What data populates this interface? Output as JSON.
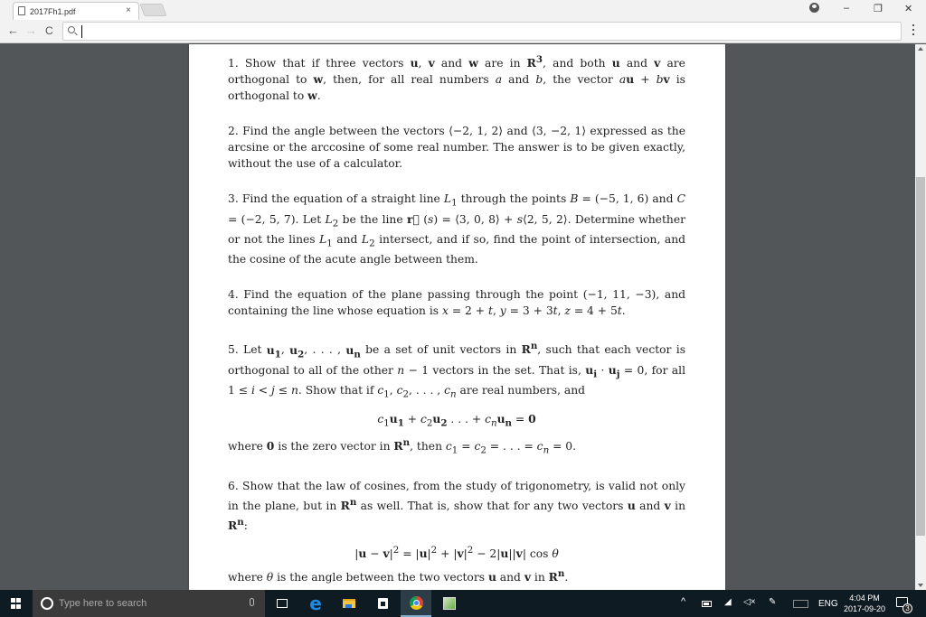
{
  "browser": {
    "tab_title": "2017Fh1.pdf",
    "tab_close": "×",
    "omnibox_value": "",
    "window_controls": {
      "minimize": "–",
      "restore": "❐",
      "close": "✕"
    },
    "nav": {
      "back": "←",
      "forward": "→",
      "reload": "C"
    }
  },
  "document": {
    "problems": [
      {
        "number": "1.",
        "html": "Show that if three vectors <b>u</b>, <b>v</b> and <b>w</b> are in <b>R</b><sup><b>3</b></sup>, and both <b>u</b> and <b>v</b> are orthogonal to <b>w</b>, then, for all real numbers <i>a</i> and <i>b</i>, the vector <i>a</i><b>u</b> + <i>b</i><b>v</b> is orthogonal to <b>w</b>."
      },
      {
        "number": "2.",
        "html": "Find the angle between the vectors ⟨−2, 1, 2⟩ and ⟨3, −2, 1⟩ expressed as the arcsine or the arccosine of some real number. The answer is to be given exactly, without the use of a calculator."
      },
      {
        "number": "3.",
        "html": "Find the equation of a straight line <i>L</i><sub>1</sub> through the points <i>B</i> = (−5, 1, 6) and <i>C</i> = (−2, 5, 7). Let <i>L</i><sub>2</sub> be the line <b>r⃗</b> (<i>s</i>) = ⟨3, 0, 8⟩ + <i>s</i>⟨2, 5, 2⟩. Determine whether or not the lines <i>L</i><sub>1</sub> and <i>L</i><sub>2</sub> intersect, and if so, find the point of intersection, and the cosine of the acute angle between them."
      },
      {
        "number": "4.",
        "html": "Find the equation of the plane passing through the point (−1, 11, −3), and containing the line whose equation is <i>x</i> = 2 + <i>t</i>, <i>y</i> = 3 + 3<i>t</i>, <i>z</i> = 4 + 5<i>t</i>."
      },
      {
        "number": "5.",
        "html": "Let <b>u<sub>1</sub></b>, <b>u<sub>2</sub></b>, . . . , <b>u<sub>n</sub></b> be a set of unit vectors in <b>R</b><sup><b>n</b></sup>, such that each vector is orthogonal to all of the other <i>n</i> − 1 vectors in the set. That is, <b>u<sub>i</sub></b> · <b>u<sub>j</sub></b> = 0, for all 1 ≤ <i>i</i> &lt; <i>j</i> ≤ <i>n</i>. Show that if <i>c</i><sub>1</sub>, <i>c</i><sub>2</sub>, . . . , <i>c<sub>n</sub></i> are real numbers, and",
        "equation": "<i>c</i><sub>1</sub><b>u<sub>1</sub></b> + <i>c</i><sub>2</sub><b>u<sub>2</sub></b> . . . + <i>c<sub>n</sub></i><b>u<sub>n</sub></b> = <b>0</b>",
        "after": "where <b>0</b> is the zero vector in <b>R</b><sup><b>n</b></sup>, then <i>c</i><sub>1</sub> = <i>c</i><sub>2</sub> = . . . = <i>c<sub>n</sub></i> = 0."
      },
      {
        "number": "6.",
        "html": "Show that the law of cosines, from the study of trigonometry, is valid not only in the plane, but in <b>R</b><sup><b>n</b></sup> as well. That is, show that for any two vectors <b>u</b> and <b>v</b> in <b>R</b><sup><b>n</b></sup>:",
        "equation": "|<b>u</b> − <b>v</b>|<sup>2</sup> = |<b>u</b>|<sup>2</sup> + |<b>v</b>|<sup>2</sup> − 2|<b>u</b>||<b>v</b>| cos <i>θ</i>",
        "after": "where <i>θ</i> is the angle between the two vectors <b>u</b> and <b>v</b> in <b>R</b><sup><b>n</b></sup>."
      }
    ]
  },
  "taskbar": {
    "search_placeholder": "Type here to search",
    "apps": [
      "task-view",
      "edge",
      "file-explorer",
      "store",
      "chrome",
      "notepad-plus"
    ],
    "active_app": "chrome",
    "tray": {
      "language": "ENG",
      "time": "4:04 PM",
      "date": "2017-09-20",
      "notification_count": "3"
    }
  }
}
